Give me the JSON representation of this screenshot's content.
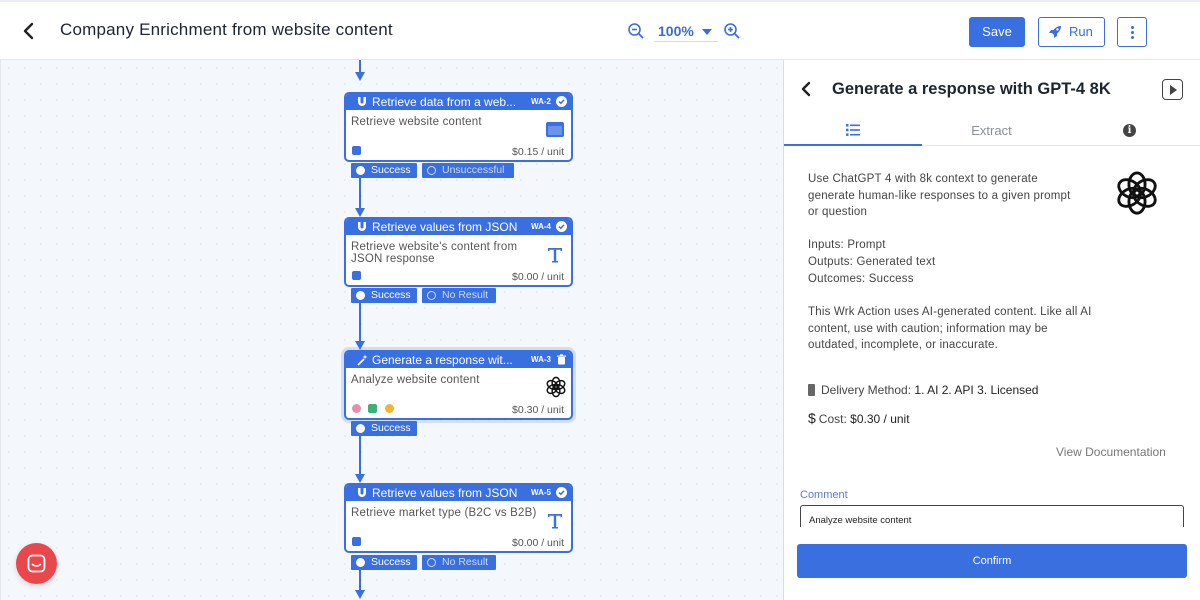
{
  "header": {
    "title": "Company Enrichment from website content",
    "zoom": "100%",
    "save_label": "Save",
    "run_label": "Run"
  },
  "canvas": {
    "nodes": [
      {
        "title": "Retrieve data from a web...",
        "code": "WA-2",
        "description": "Retrieve website content",
        "price": "$0.15 / unit",
        "icon": "browser-window-icon",
        "outcomes": [
          "Success",
          "Unsuccessful"
        ]
      },
      {
        "title": "Retrieve values from JSON",
        "code": "WA-4",
        "description": "Retrieve website's content from JSON response",
        "price": "$0.00 / unit",
        "icon": "text-T-icon",
        "outcomes": [
          "Success",
          "No Result"
        ]
      },
      {
        "title": "Generate a response wit...",
        "code": "WA-3",
        "description": "Analyze website content",
        "price": "$0.30 / unit",
        "icon": "openai-icon",
        "outcomes": [
          "Success"
        ]
      },
      {
        "title": "Retrieve values from JSON",
        "code": "WA-5",
        "description": "Retrieve market type (B2C vs B2B)",
        "price": "$0.00 / unit",
        "icon": "text-T-icon",
        "outcomes": [
          "Success",
          "No Result"
        ]
      }
    ]
  },
  "panel": {
    "title": "Generate a response with GPT-4 8K",
    "tabs": [
      "list-icon",
      "Extract",
      "info-icon"
    ],
    "description": "Use ChatGPT 4 with 8k context to generate generate human-like responses to a given prompt or question",
    "inputs": "Inputs: Prompt",
    "outputs": "Outputs: Generated text",
    "outcomes": "Outcomes: Success",
    "disclaimer": "This Wrk Action uses AI-generated content. Like all AI content, use with caution; information may be outdated, incomplete, or inaccurate.",
    "delivery_label": "Delivery Method:",
    "delivery_value": "1. AI 2. API 3. Licensed",
    "cost_label": "Cost:",
    "cost_value": "$0.30 / unit",
    "view_doc": "View Documentation",
    "comment_label": "Comment",
    "comment_value": "Analyze website content",
    "confirm_label": "Confirm"
  },
  "colors": {
    "accent": "#3a6fe0",
    "chat_launcher": "#e8484c"
  }
}
